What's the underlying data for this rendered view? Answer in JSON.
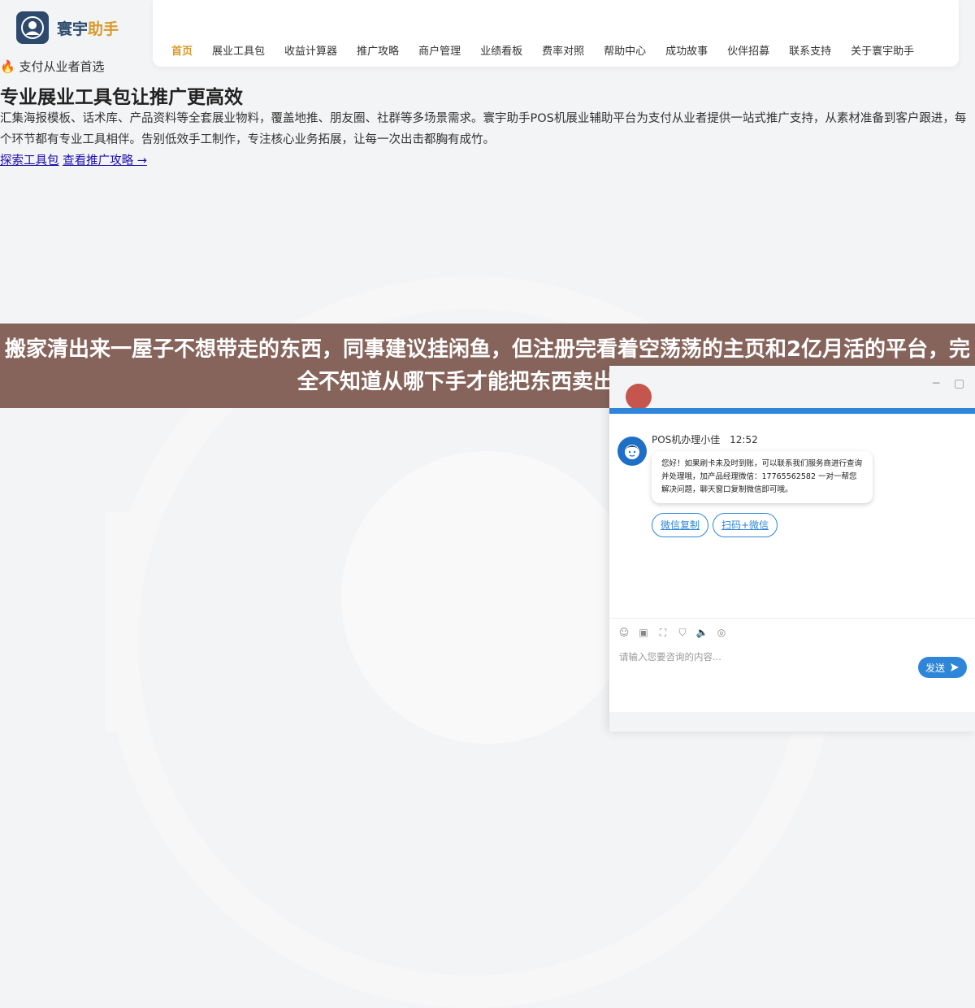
{
  "brand": {
    "name_main": "寰宇",
    "name_accent": "助手",
    "color_primary": "#2d4a6c",
    "color_accent": "#d99a2b"
  },
  "nav": {
    "items": [
      {
        "label": "首页",
        "active": true
      },
      {
        "label": "展业工具包"
      },
      {
        "label": "收益计算器"
      },
      {
        "label": "推广攻略"
      },
      {
        "label": "商户管理"
      },
      {
        "label": "业绩看板"
      },
      {
        "label": "费率对照"
      },
      {
        "label": "帮助中心"
      },
      {
        "label": "成功故事"
      },
      {
        "label": "伙伴招募"
      },
      {
        "label": "联系支持"
      },
      {
        "label": "关于寰宇助手"
      }
    ]
  },
  "hero": {
    "tagline": "支付从业者首选",
    "tagline_icon": "fire-icon",
    "title": "专业展业工具包让推广更高效",
    "description": "汇集海报模板、话术库、产品资料等全套展业物料，覆盖地推、朋友圈、社群等多场景需求。寰宇助手POS机展业辅助平台为支付从业者提供一站式推广支持，从素材准备到客户跟进，每个环节都有专业工具相伴。告别低效手工制作，专注核心业务拓展，让每一次出击都胸有成竹。",
    "link_primary": "探索工具包",
    "link_secondary": "查看推广攻略 →"
  },
  "banner": {
    "text": "搬家清出来一屋子不想带走的东西，同事建议挂闲鱼，但注册完看着空荡荡的主页和2亿月活的平台，完全不知道从哪下手才能把东西卖出去。花"
  },
  "chat": {
    "minimize": "─",
    "maximize": "▢",
    "agent_name": "POS机办理小佳",
    "time": "12:52",
    "message": "您好！如果刷卡未及时到账，可以联系我们服务商进行查询并处理哦，加产品经理微信：17765562582 一对一帮您解决问题，聊天窗口复制微信即可哦。",
    "quick_replies": [
      "微信复制",
      "扫码+微信"
    ],
    "toolbar_icons": [
      "smile-icon",
      "image-icon",
      "screenshot-icon",
      "shield-icon",
      "volume-icon",
      "wechat-icon"
    ],
    "input_placeholder": "请输入您要咨询的内容...",
    "send_label": "发送",
    "accent_color": "#2f86d8"
  }
}
